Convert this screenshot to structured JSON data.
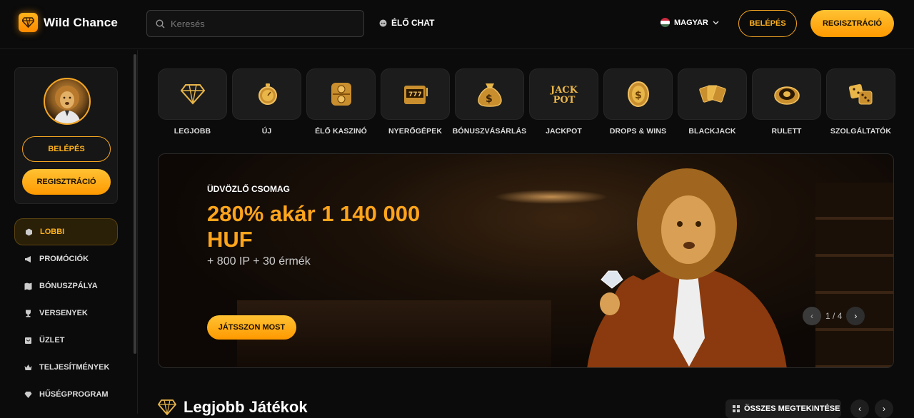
{
  "brand": {
    "name": "Wild Chance",
    "accent": "#ff9900"
  },
  "search": {
    "placeholder": "Keresés",
    "value": ""
  },
  "header": {
    "live_chat": "ÉLŐ CHAT",
    "language": "MAGYAR",
    "login": "BELÉPÉS",
    "register": "REGISZTRÁCIÓ"
  },
  "sidebar": {
    "login": "BELÉPÉS",
    "register": "REGISZTRÁCIÓ",
    "items": [
      {
        "label": "LOBBI",
        "icon": "cube-icon",
        "active": true
      },
      {
        "label": "PROMÓCIÓK",
        "icon": "megaphone-icon"
      },
      {
        "label": "BÓNUSZPÁLYA",
        "icon": "map-icon"
      },
      {
        "label": "VERSENYEK",
        "icon": "trophy-icon"
      },
      {
        "label": "ÜZLET",
        "icon": "shop-icon"
      },
      {
        "label": "TELJESÍTMÉNYEK",
        "icon": "crown-icon"
      },
      {
        "label": "HŰSÉGPROGRAM",
        "icon": "diamond-icon"
      }
    ]
  },
  "categories": [
    {
      "label": "LEGJOBB",
      "icon": "diamond-icon"
    },
    {
      "label": "ÚJ",
      "icon": "stopwatch-icon"
    },
    {
      "label": "ÉLŐ KASZINÓ",
      "icon": "chip-icon"
    },
    {
      "label": "NYERŐGÉPEK",
      "icon": "slot-machine-icon"
    },
    {
      "label": "BÓNUSZVÁSÁRLÁS",
      "icon": "money-bag-icon"
    },
    {
      "label": "JACKPOT",
      "icon": "jackpot-icon",
      "icon_text": "JACK POT"
    },
    {
      "label": "DROPS & WINS",
      "icon": "coin-icon"
    },
    {
      "label": "BLACKJACK",
      "icon": "cards-icon"
    },
    {
      "label": "RULETT",
      "icon": "roulette-icon"
    },
    {
      "label": "SZOLGÁLTATÓK",
      "icon": "dice-icon"
    }
  ],
  "hero": {
    "eyebrow": "ÜDVÖZLŐ CSOMAG",
    "title": "280% akár 1 140 000 HUF",
    "subtitle": "+ 800 IP + 30 érmék",
    "cta": "JÁTSSZON MOST",
    "pager_current": "1",
    "pager_total": "4"
  },
  "section": {
    "title": "Legjobb Játékok",
    "view_all": "ÖSSZES MEGTEKINTÉSE"
  }
}
